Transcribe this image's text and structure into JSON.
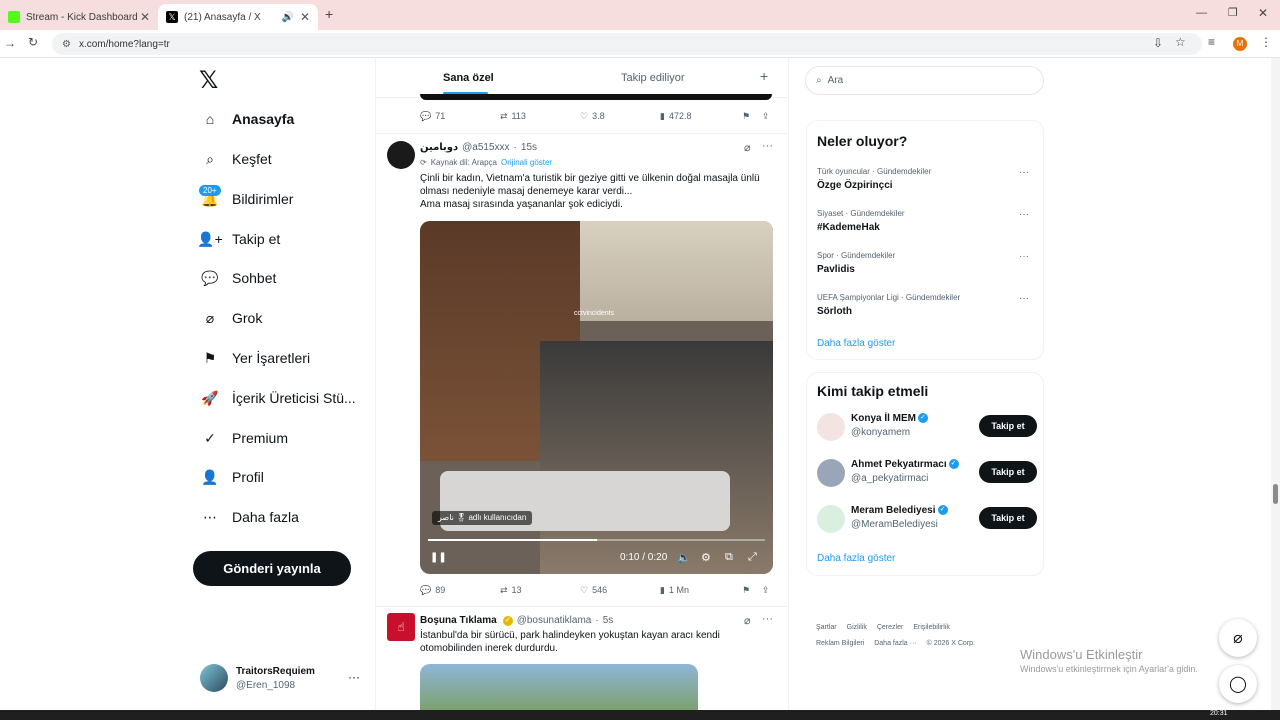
{
  "browser": {
    "tabs": [
      {
        "title": "Stream - Kick Dashboard",
        "favicon_color": "#53fc18"
      },
      {
        "title": "(21) Anasayfa / X",
        "favicon_color": "#000000"
      }
    ],
    "url": "x.com/home?lang=tr",
    "profile_initial": "M"
  },
  "nav": {
    "items": [
      {
        "label": "Anasayfa",
        "icon": "home-icon"
      },
      {
        "label": "Keşfet",
        "icon": "search-icon"
      },
      {
        "label": "Bildirimler",
        "icon": "bell-icon"
      },
      {
        "label": "Takip et",
        "icon": "follow-icon"
      },
      {
        "label": "Sohbet",
        "icon": "chat-icon"
      },
      {
        "label": "Grok",
        "icon": "grok-icon"
      },
      {
        "label": "Yer İşaretleri",
        "icon": "bookmark-icon"
      },
      {
        "label": "İçerik Üreticisi Stü...",
        "icon": "rocket-icon"
      },
      {
        "label": "Premium",
        "icon": "premium-icon"
      },
      {
        "label": "Profil",
        "icon": "profile-icon"
      },
      {
        "label": "Daha fazla",
        "icon": "more-circle-icon"
      }
    ],
    "notif_badge": "20+",
    "post_button": "Gönderi yayınla",
    "account": {
      "name": "TraitorsRequiem",
      "handle": "@Eren_1098"
    }
  },
  "feed": {
    "tabs": {
      "for_you": "Sana özel",
      "following": "Takip ediliyor"
    },
    "prev_actions": {
      "replies": "71",
      "reposts": "113",
      "likes": "3.8",
      "views": "472.8"
    },
    "tweet1": {
      "name": "دوبامين",
      "handle": "@a515xxx",
      "time": "15s",
      "translate_note": "Kaynak dil: Arapça",
      "translate_link": "Orijinali göster",
      "text_line1": "Çinli bir kadın, Vietnam'a turistik bir geziye gitti ve ülkenin doğal masajla ünlü",
      "text_line2": "olması nedeniyle masaj denemeye karar verdi...",
      "text_line3": "Ama masaj sırasında yaşananlar şok ediciydi.",
      "video_watermark": "cctvincidents",
      "video_from": "ناصر 🎖 adlı kullanıcıdan",
      "video_time": "0:10 / 0:20",
      "video_progress": 0.5,
      "actions": {
        "replies": "89",
        "reposts": "13",
        "likes": "546",
        "views": "1 Mn"
      }
    },
    "tweet2": {
      "name": "Boşuna Tıklama",
      "handle": "@bosunatiklama",
      "time": "5s",
      "text_line1": "İstanbul'da bir sürücü, park halindeyken yokuştan kayan aracı kendi",
      "text_line2": "otomobilinden inerek durdurdu."
    }
  },
  "sidebar": {
    "search_placeholder": "Ara",
    "trends_title": "Neler oluyor?",
    "trends": [
      {
        "category": "Türk oyuncular · Gündemdekiler",
        "name": "Özge Özpirinçci"
      },
      {
        "category": "Siyaset · Gündemdekiler",
        "name": "#KademeHak"
      },
      {
        "category": "Spor · Gündemdekiler",
        "name": "Pavlidis"
      },
      {
        "category": "UEFA Şampiyonlar Ligi · Gündemdekiler",
        "name": "Sörloth"
      }
    ],
    "trends_more": "Daha fazla göster",
    "who_title": "Kimi takip etmeli",
    "who": [
      {
        "name": "Konya İl MEM",
        "handle": "@konyamem"
      },
      {
        "name": "Ahmet Pekyatırmacı",
        "handle": "@a_pekyatirmaci"
      },
      {
        "name": "Meram Belediyesi",
        "handle": "@MeramBelediyesi"
      }
    ],
    "follow_label": "Takip et",
    "who_more": "Daha fazla göster",
    "footer": {
      "line1": [
        "Şartlar",
        "Gizlilik",
        "Çerezler",
        "Erişilebilirlik"
      ],
      "line2": [
        "Reklam Bilgileri",
        "Daha fazla ···",
        "© 2026 X Corp."
      ]
    }
  },
  "windows_watermark": {
    "title": "Windows'u Etkinleştir",
    "subtitle": "Windows'u etkinleştirmek için Ayarlar'a gidin."
  },
  "taskbar_time": "20:31"
}
